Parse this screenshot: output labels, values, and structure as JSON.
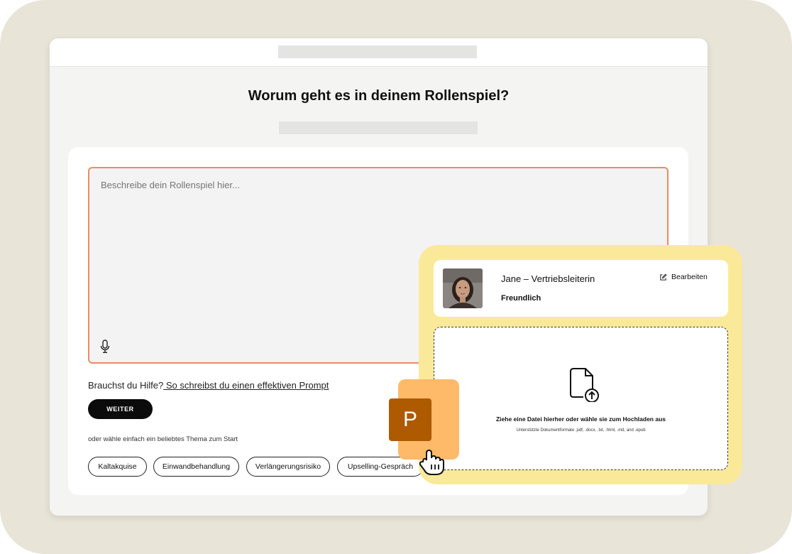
{
  "main": {
    "title": "Worum geht es in deinem Rollenspiel?",
    "textarea_placeholder": "Beschreibe dein Rollenspiel hier...",
    "help_prefix": "Brauchst du Hilfe?",
    "help_link": " So schreibst du einen effektiven Prompt",
    "continue_label": "WEITER",
    "topic_hint": "oder wähle einfach ein beliebtes Thema zum Start",
    "topics": [
      "Kaltakquise",
      "Einwandbehandlung",
      "Verlängerungsrisiko",
      "Upselling-Gespräch"
    ]
  },
  "persona": {
    "name": "Jane – Vertriebsleiterin",
    "mood": "Freundlich",
    "edit_label": "Bearbeiten"
  },
  "upload": {
    "title": "Ziehe eine Datei hierher oder wähle sie zum Hochladen aus",
    "subtitle": "Unterstützte Dokumentformate .pdf, .docx, .txt, .html, .md, and .epub"
  },
  "drag_file": {
    "letter": "P"
  },
  "colors": {
    "accent_border": "#ec8b63",
    "panel_bg": "#fbe99a",
    "ppt_orange": "#feb969",
    "ppt_dark": "#ae5a00"
  },
  "icons": [
    "microphone-icon",
    "edit-icon",
    "file-upload-icon",
    "hand-cursor-icon"
  ]
}
